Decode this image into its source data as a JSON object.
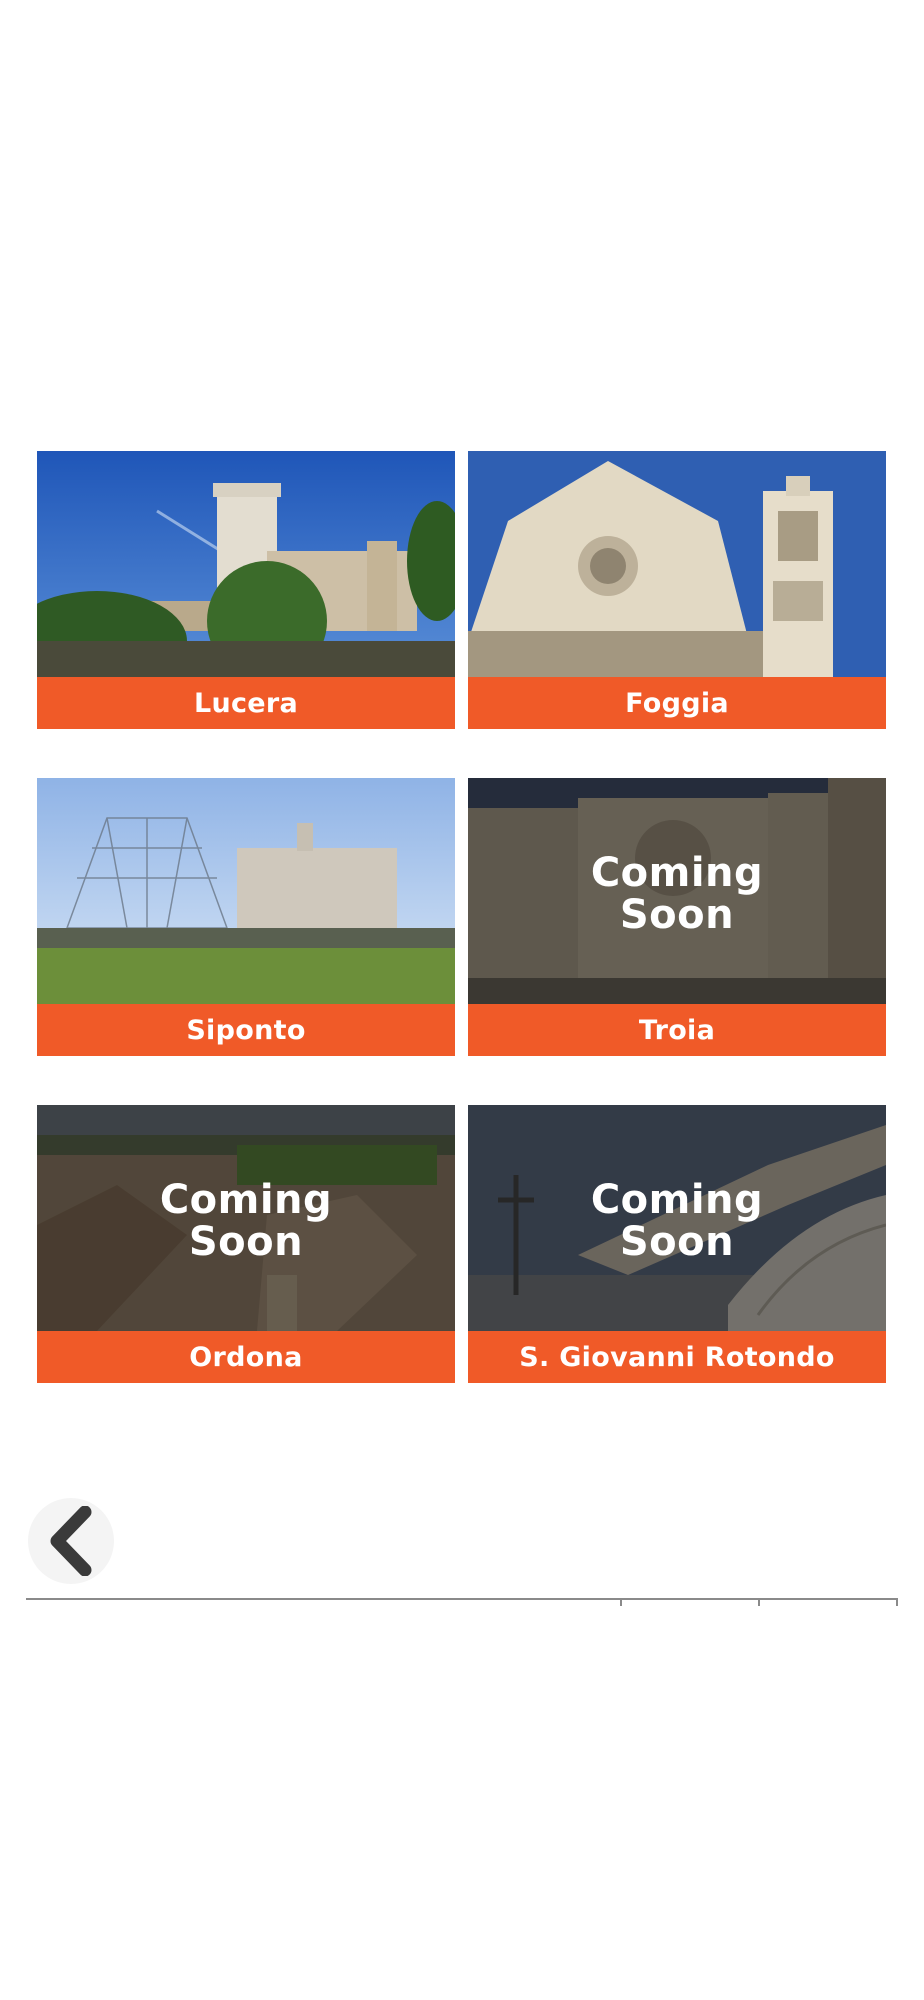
{
  "cards": [
    {
      "name": "Lucera",
      "coming_soon": ""
    },
    {
      "name": "Foggia",
      "coming_soon": ""
    },
    {
      "name": "Siponto",
      "coming_soon": ""
    },
    {
      "name": "Troia",
      "coming_soon": "Coming\nSoon"
    },
    {
      "name": "Ordona",
      "coming_soon": "Coming\nSoon"
    },
    {
      "name": "S. Giovanni Rotondo",
      "coming_soon": "Coming\nSoon"
    }
  ],
  "colors": {
    "label_bg": "#f05a28",
    "label_text": "#ffffff",
    "back_icon": "#3a3a3a"
  },
  "icons": {
    "back": "chevron-left-icon"
  }
}
